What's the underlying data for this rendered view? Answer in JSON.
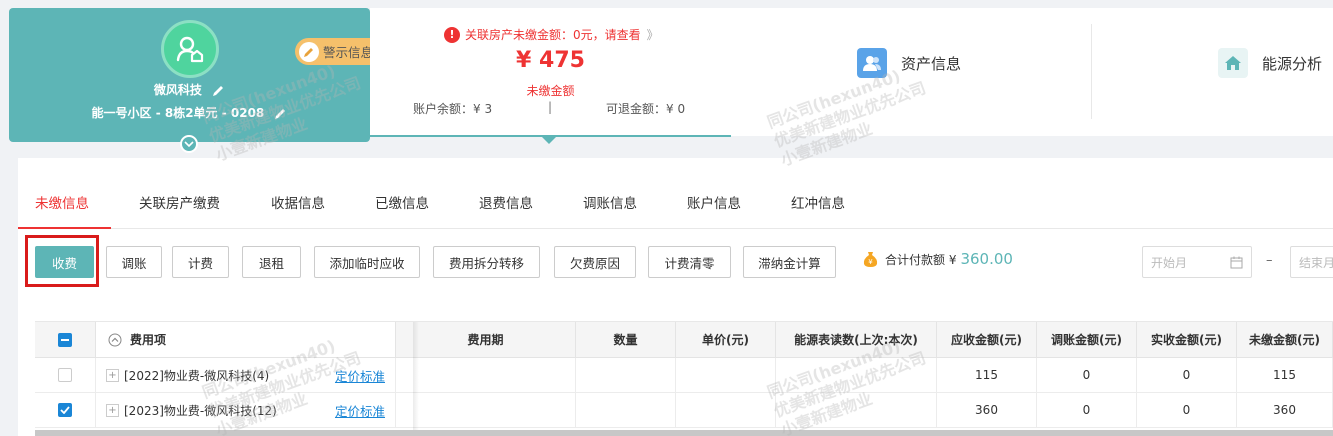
{
  "card": {
    "name": "微风科技",
    "address": "能一号小区 - 8栋2单元 - 0208",
    "warning_tag": "警示信息"
  },
  "amount": {
    "alert_text": "关联房产未缴金额：0元，请查看",
    "alert_more": "》",
    "unpaid_value": "¥ 475",
    "unpaid_label": "未缴金额",
    "balance": "账户余额：¥ 3",
    "separator": "|",
    "refundable": "可退金额：¥ 0"
  },
  "nav": {
    "asset_info": "资产信息",
    "energy_analysis": "能源分析"
  },
  "tabs": [
    {
      "label": "未缴信息",
      "active": true
    },
    {
      "label": "关联房产缴费"
    },
    {
      "label": "收据信息"
    },
    {
      "label": "已缴信息"
    },
    {
      "label": "退费信息"
    },
    {
      "label": "调账信息"
    },
    {
      "label": "账户信息"
    },
    {
      "label": "红冲信息"
    }
  ],
  "toolbar": {
    "collect": "收费",
    "adjust": "调账",
    "billing": "计费",
    "rent_back": "退租",
    "add_temp": "添加临时应收",
    "split_transfer": "费用拆分转移",
    "arrears_reason": "欠费原因",
    "billing_clear": "计费清零",
    "late_fee": "滞纳金计算",
    "total_label": "合计付款额 ¥",
    "total_value": "360.00",
    "start_month_placeholder": "开始月",
    "date_dash": "–",
    "end_month_placeholder": "结束月"
  },
  "table": {
    "headers": {
      "fee_item": "费用项",
      "period": "费用期",
      "quantity": "数量",
      "unit_price": "单价(元)",
      "meter": "能源表读数(上次:本次)",
      "receivable": "应收金额(元)",
      "adjust_amount": "调账金额(元)",
      "received": "实收金额(元)",
      "unpaid": "未缴金额(元)"
    },
    "rows": [
      {
        "checked": false,
        "fee_item": "[2022]物业费-微风科技(4)",
        "link": "定价标准",
        "period": "",
        "quantity": "",
        "unit_price": "",
        "meter": "",
        "receivable": "115",
        "adjust_amount": "0",
        "received": "0",
        "unpaid": "115"
      },
      {
        "checked": true,
        "fee_item": "[2023]物业费-微风科技(12)",
        "link": "定价标准",
        "period": "",
        "quantity": "",
        "unit_price": "",
        "meter": "",
        "receivable": "360",
        "adjust_amount": "0",
        "received": "0",
        "unpaid": "360"
      }
    ]
  },
  "watermark": {
    "line1": "同公司(hexun40)",
    "line2": "优美新建物业优先公司",
    "line3": "小壹新建物业"
  },
  "colors": {
    "accent": "#5db5b6",
    "alert": "#e33333",
    "link": "#1a86d6",
    "highlight_box": "#d91b1b"
  }
}
